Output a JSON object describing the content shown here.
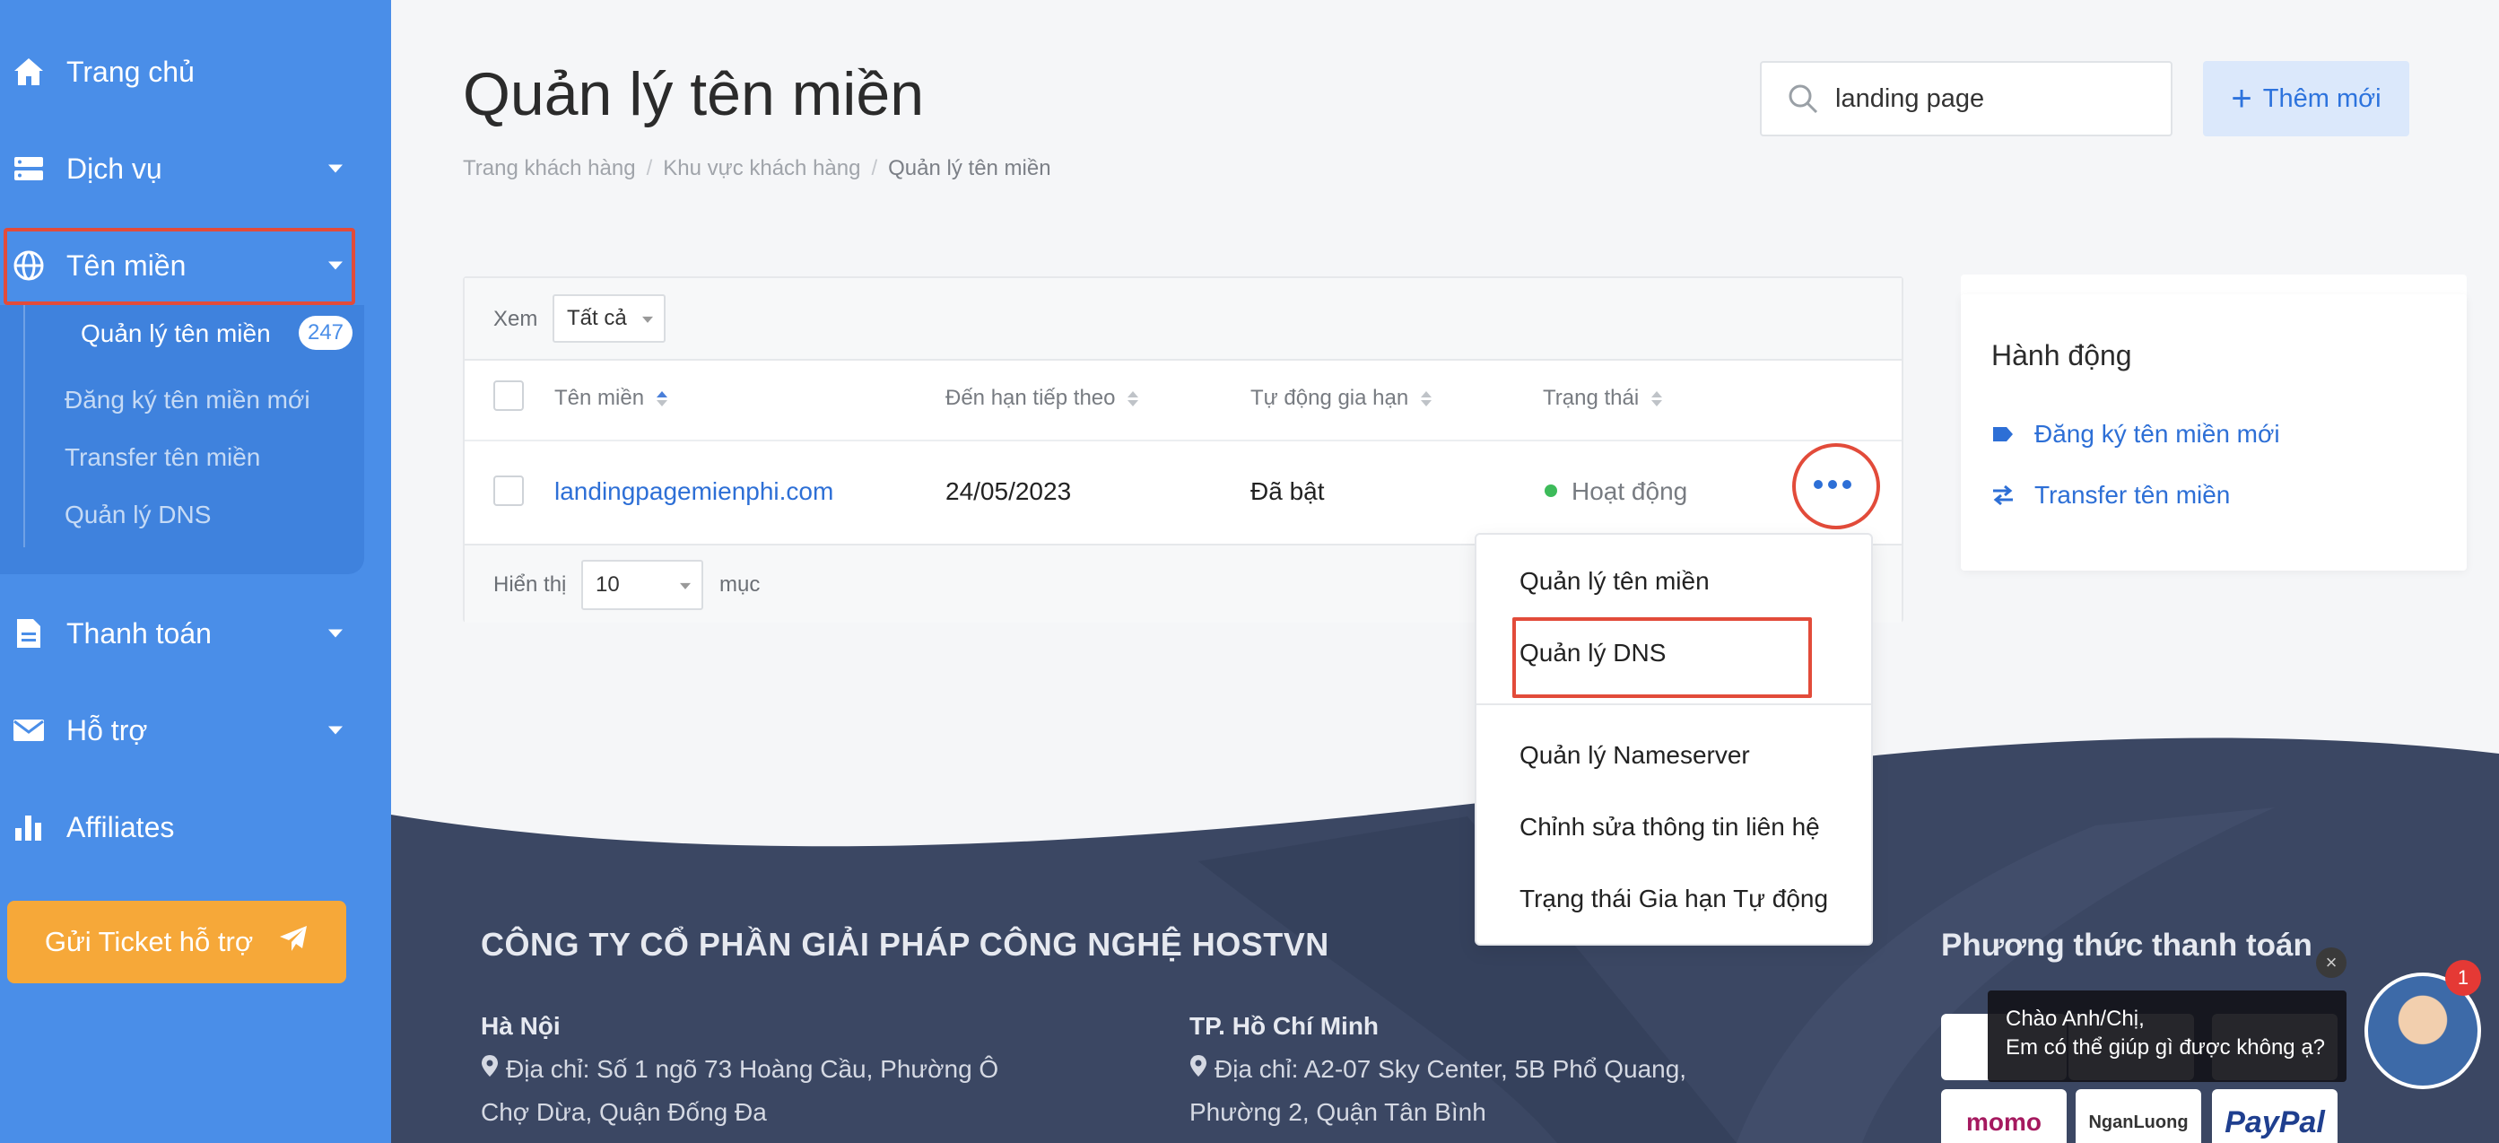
{
  "colors": {
    "sidebar_bg": "#4a8ee8",
    "accent_blue": "#2d6fd6",
    "highlight_red": "#e24b3a",
    "ticket_orange": "#f6a839",
    "footer_navy": "#3b4763",
    "status_green": "#3dbb5a"
  },
  "sidebar": {
    "items": [
      {
        "label": "Trang chủ",
        "icon": "home-icon"
      },
      {
        "label": "Dịch vụ",
        "icon": "server-icon"
      },
      {
        "label": "Tên miền",
        "icon": "globe-icon"
      },
      {
        "label": "Thanh toán",
        "icon": "document-icon"
      },
      {
        "label": "Hỗ trợ",
        "icon": "mail-icon"
      },
      {
        "label": "Affiliates",
        "icon": "bar-chart-icon"
      }
    ],
    "submenu": [
      {
        "label": "Quản lý tên miền",
        "badge": "247"
      },
      {
        "label": "Đăng ký tên miền mới"
      },
      {
        "label": "Transfer tên miền"
      },
      {
        "label": "Quản lý DNS"
      }
    ],
    "ticket_button": "Gửi Ticket hỗ trợ"
  },
  "header": {
    "title": "Quản lý tên miền",
    "breadcrumb": [
      "Trang khách hàng",
      "Khu vực khách hàng",
      "Quản lý tên miền"
    ],
    "search_value": "landing page",
    "add_button": "Thêm mới"
  },
  "table": {
    "filter_label": "Xem",
    "filter_value": "Tất cả",
    "columns": [
      "Tên miền",
      "Đến hạn tiếp theo",
      "Tự động gia hạn",
      "Trạng thái"
    ],
    "rows": [
      {
        "domain": "landingpagemienphi.com",
        "due": "24/05/2023",
        "auto_renew": "Đã bật",
        "status": "Hoạt động"
      }
    ],
    "show_label": "Hiển thị",
    "page_size": "10",
    "unit_label": "mục"
  },
  "dropdown": {
    "items": [
      "Quản lý tên miền",
      "Quản lý DNS",
      "Quản lý Nameserver",
      "Chỉnh sửa thông tin liên hệ",
      "Trạng thái Gia hạn Tự động"
    ]
  },
  "actions": {
    "title": "Hành động",
    "items": [
      {
        "label": "Đăng ký tên miền mới",
        "icon": "tag-icon"
      },
      {
        "label": "Transfer tên miền",
        "icon": "swap-icon"
      }
    ]
  },
  "footer": {
    "company": "CÔNG TY CỔ PHẦN GIẢI PHÁP CÔNG NGHỆ HOSTVN",
    "hanoi": {
      "city": "Hà Nội",
      "addr_line1": "Địa chỉ: Số 1 ngõ 73 Hoàng Cầu, Phường Ô",
      "addr_line2": "Chợ Dừa, Quận Đống Đa"
    },
    "hcm": {
      "city": "TP. Hồ Chí Minh",
      "addr_line1": "Địa chỉ: A2-07 Sky Center, 5B Phổ Quang,",
      "addr_line2": "Phường 2, Quận Tân Bình"
    },
    "payment_title": "Phương thức thanh toán",
    "payment_logos": [
      "momo",
      "NganLuong",
      "PayPal"
    ]
  },
  "chat": {
    "line1": "Chào Anh/Chị,",
    "line2": "Em có thể giúp gì được không ạ?",
    "badge": "1"
  }
}
